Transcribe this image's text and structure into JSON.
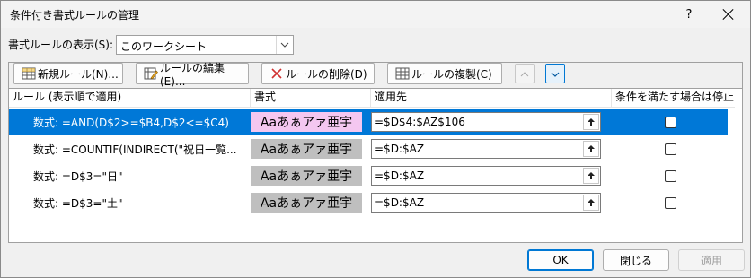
{
  "window": {
    "title": "条件付き書式ルールの管理",
    "help_glyph": "?"
  },
  "show_rules": {
    "label": "書式ルールの表示(S):",
    "selected": "このワークシート"
  },
  "toolbar": {
    "new_rule": "新規ルール(N)...",
    "edit_rule": "ルールの編集(E)...",
    "delete_rule": "ルールの削除(D)",
    "duplicate_rule": "ルールの複製(C)"
  },
  "columns": {
    "rule": "ルール (表示順で適用)",
    "format": "書式",
    "applies_to": "適用先",
    "stop_if_true": "条件を満たす場合は停止"
  },
  "rules": [
    {
      "rule": "数式: =AND(D$2>=$B4,D$2<=$C4)",
      "preview": "Aaあぁアァ亜宇",
      "preview_color": "#f4c7f0",
      "applies_to": "=$D$4:$AZ$106",
      "stop_if_true": false,
      "selected": true
    },
    {
      "rule": "数式: =COUNTIF(INDIRECT(\"祝日一覧...",
      "preview": "Aaあぁアァ亜宇",
      "preview_color": "#bfbfbf",
      "applies_to": "=$D:$AZ",
      "stop_if_true": false,
      "selected": false
    },
    {
      "rule": "数式: =D$3=\"日\"",
      "preview": "Aaあぁアァ亜宇",
      "preview_color": "#bfbfbf",
      "applies_to": "=$D:$AZ",
      "stop_if_true": false,
      "selected": false
    },
    {
      "rule": "数式: =D$3=\"土\"",
      "preview": "Aaあぁアァ亜宇",
      "preview_color": "#bfbfbf",
      "applies_to": "=$D:$AZ",
      "stop_if_true": false,
      "selected": false
    }
  ],
  "footer": {
    "ok": "OK",
    "close": "閉じる",
    "apply": "適用"
  },
  "colors": {
    "accent": "#0078d7",
    "selected_preview": "#f4c7f0",
    "default_preview": "#bfbfbf"
  }
}
